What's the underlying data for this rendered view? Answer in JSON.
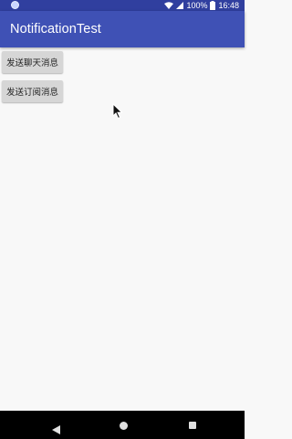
{
  "status_bar": {
    "battery_percent": "100%",
    "time": "16:48",
    "icons": [
      "notification-dot-icon",
      "wifi-icon",
      "signal-icon",
      "battery-icon"
    ]
  },
  "app_bar": {
    "title": "NotificationTest",
    "color": "#3f51b5",
    "status_color": "#303f9f"
  },
  "buttons": {
    "send_chat": "发送聊天消息",
    "send_subscribe": "发送订阅消息"
  },
  "nav_bar": {
    "icons": [
      "back-icon",
      "home-icon",
      "recents-icon"
    ]
  }
}
